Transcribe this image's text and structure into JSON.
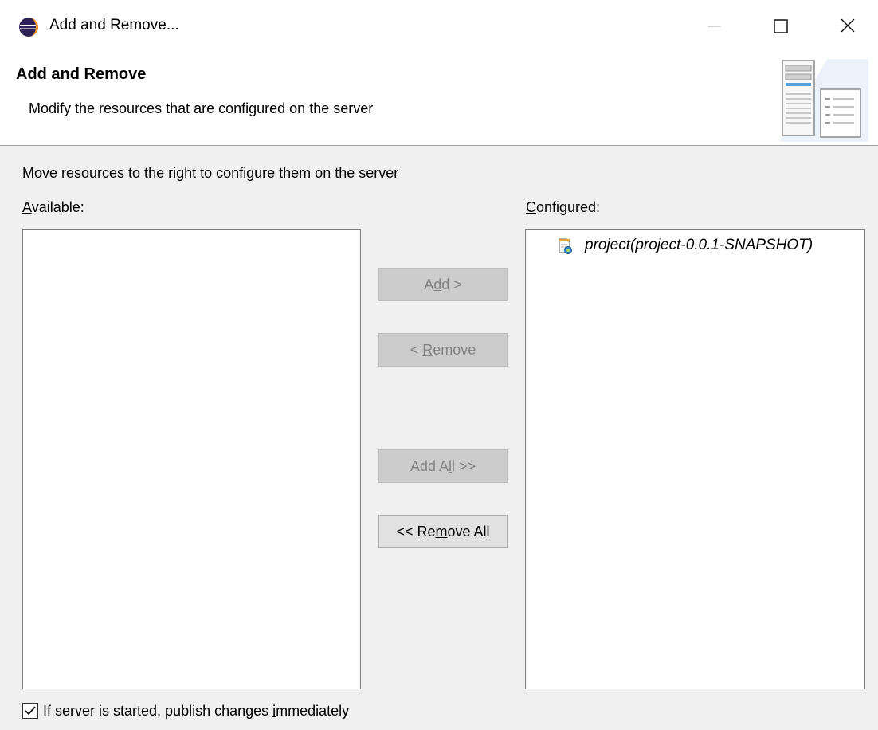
{
  "window": {
    "title": "Add and Remove...",
    "app_icon": "eclipse-icon",
    "controls": [
      "minimize-icon",
      "maximize-icon",
      "close-icon"
    ]
  },
  "banner": {
    "title": "Add and Remove",
    "description": "Modify the resources that are configured on the server",
    "image": "server-resources-icon"
  },
  "instructions": "Move resources to the right to configure them on the server",
  "available": {
    "label_mnemonic": "A",
    "label_rest": "vailable:",
    "items": []
  },
  "configured": {
    "label_mnemonic": "C",
    "label_rest": "onfigured:",
    "items": [
      {
        "label": "project(project-0.0.1-SNAPSHOT)",
        "icon": "web-module-icon"
      }
    ]
  },
  "buttons": {
    "add": {
      "pre": "A",
      "mnemonic": "d",
      "post": "d >",
      "enabled": false
    },
    "remove": {
      "pre": "< ",
      "mnemonic": "R",
      "post": "emove",
      "enabled": false
    },
    "add_all": {
      "pre": "Add A",
      "mnemonic": "l",
      "post": "l >>",
      "enabled": false
    },
    "remove_all": {
      "pre": "<< Re",
      "mnemonic": "m",
      "post": "ove All",
      "enabled": true
    }
  },
  "publish": {
    "checked": true,
    "label_pre": "If server is started, publish changes ",
    "label_mnemonic": "i",
    "label_post": "mmediately"
  }
}
